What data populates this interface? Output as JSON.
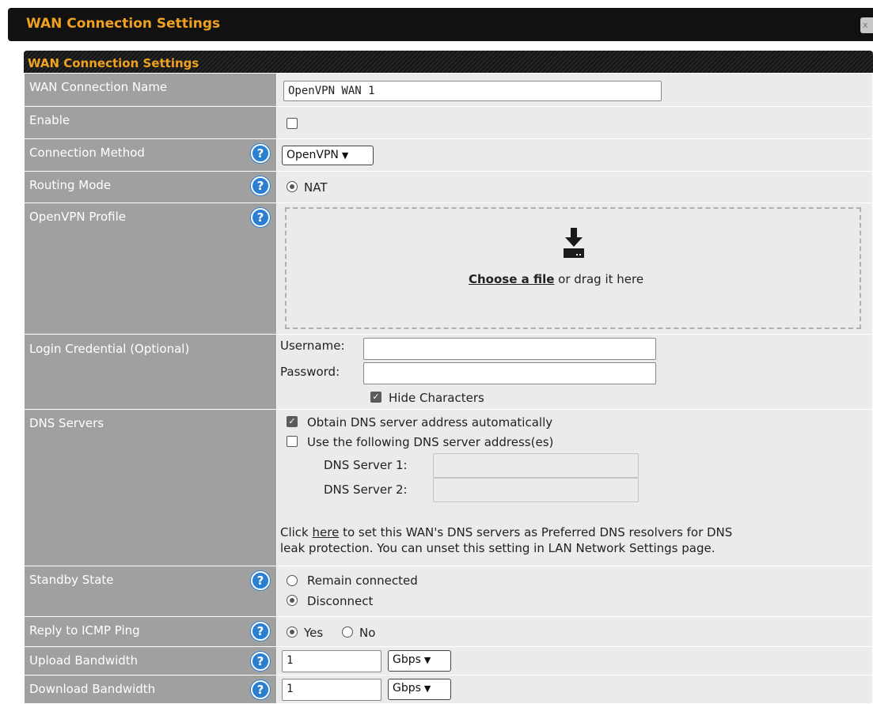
{
  "dialog": {
    "title": "WAN Connection Settings",
    "close_glyph": "x"
  },
  "section": {
    "header": "WAN Connection Settings"
  },
  "rows": {
    "name": {
      "label": "WAN Connection Name",
      "value": "OpenVPN WAN 1"
    },
    "enable": {
      "label": "Enable",
      "checked": false
    },
    "method": {
      "label": "Connection Method",
      "selected": "OpenVPN"
    },
    "routing": {
      "label": "Routing Mode",
      "option": "NAT"
    },
    "profile": {
      "label": "OpenVPN Profile",
      "choose": "Choose a file",
      "drag": " or drag it here"
    },
    "login": {
      "label": "Login Credential (Optional)",
      "username_label": "Username:",
      "password_label": "Password:",
      "username_value": "",
      "password_value": "",
      "hide_label": "Hide Characters"
    },
    "dns": {
      "label": "DNS Servers",
      "auto_label": "Obtain DNS server address automatically",
      "manual_label": "Use the following DNS server address(es)",
      "server1_label": "DNS Server 1:",
      "server2_label": "DNS Server 2:",
      "note_prefix": "Click ",
      "note_link": "here",
      "note_rest": " to set this WAN's DNS servers as Preferred DNS resolvers for DNS",
      "note_line2": "leak protection. You can unset this setting in LAN Network Settings page."
    },
    "standby": {
      "label": "Standby State",
      "opt1": "Remain connected",
      "opt2": "Disconnect"
    },
    "icmp": {
      "label": "Reply to ICMP Ping",
      "yes": "Yes",
      "no": "No"
    },
    "upload": {
      "label": "Upload Bandwidth",
      "value": "1",
      "unit": "Gbps"
    },
    "download": {
      "label": "Download Bandwidth",
      "value": "1",
      "unit": "Gbps"
    }
  },
  "help_glyph": "?",
  "icons": {
    "help": "question-circle-icon",
    "download": "download-tray-icon",
    "chevron": "chevron-down-icon"
  },
  "colors": {
    "accent": "#f0a21e",
    "label_bg": "#a0a0a0",
    "value_bg": "#ebebeb",
    "help": "#2b7fd0"
  }
}
